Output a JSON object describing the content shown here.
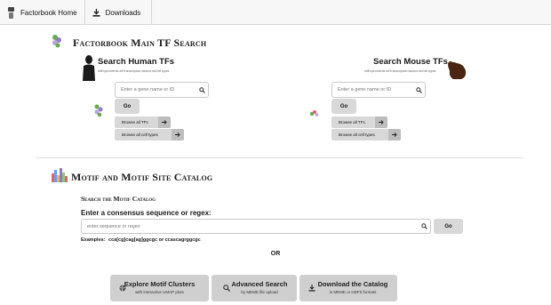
{
  "nav": {
    "home_label": "Factorbook Home",
    "downloads_label": "Downloads"
  },
  "tf_section": {
    "title": "Factorbook Main TF Search",
    "human": {
      "title": "Search Human TFs",
      "stats": "##Experiments·##Transcription factors·##Cell types",
      "placeholder": "Enter a gene name or ID",
      "go_label": "Go",
      "browse_tfs": "Browse all TFs",
      "browse_cells": "Browse all cell types"
    },
    "mouse": {
      "title": "Search Mouse TFs",
      "stats": "##Experiments·##Transcription factors·##Cell types",
      "placeholder": "Enter a gene name or ID",
      "go_label": "Go",
      "browse_tfs": "Browse all TFs",
      "browse_cells": "Browse all cell types"
    }
  },
  "motif_section": {
    "title": "Motif and Motif Site Catalog",
    "search_heading": "Search the Motif Catalog",
    "prompt": "Enter a consensus sequence or regex:",
    "placeholder": "enter sequence or regex",
    "go_label": "Go",
    "examples_label": "Examples:",
    "example1": "cca[cg]cag[ag]ggcgc",
    "or_word": "or",
    "example2": "ccascagrggcgc",
    "or_divider": "OR",
    "buttons": [
      {
        "title": "Explore Motif Clusters",
        "subtitle": "with interactive UMAP plots",
        "icon": "globe-icon"
      },
      {
        "title": "Advanced Search",
        "subtitle": "by MEME file upload",
        "icon": "search-icon"
      },
      {
        "title": "Download the Catalog",
        "subtitle": "in MEME or HDF5 formats",
        "icon": "download-icon"
      }
    ]
  },
  "colors": {
    "button_gray": "#d8d8d8",
    "arrow_gray": "#bdbdbd",
    "nav_bg": "#f7f7f7",
    "divider": "#dedede"
  }
}
